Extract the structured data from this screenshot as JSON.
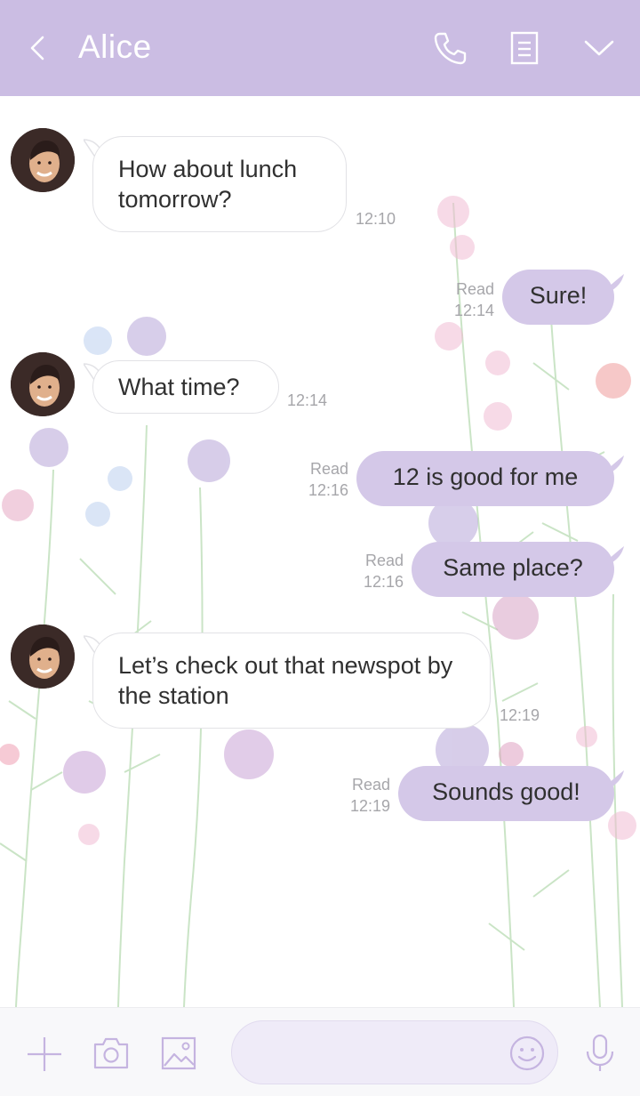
{
  "header": {
    "title": "Alice",
    "background": "#cbbde3",
    "icons": [
      "back-arrow-icon",
      "phone-icon",
      "notes-icon",
      "chevron-down-icon"
    ]
  },
  "messages": [
    {
      "from": "Alice",
      "direction": "incoming",
      "text": "How about lunch tomorrow?",
      "time": "12:10"
    },
    {
      "from": "me",
      "direction": "outgoing",
      "text": "Sure!",
      "status": "Read",
      "time": "12:14"
    },
    {
      "from": "Alice",
      "direction": "incoming",
      "text": "What time?",
      "time": "12:14"
    },
    {
      "from": "me",
      "direction": "outgoing",
      "text": "12 is good for me",
      "status": "Read",
      "time": "12:16"
    },
    {
      "from": "me",
      "direction": "outgoing",
      "text": "Same place?",
      "status": "Read",
      "time": "12:16"
    },
    {
      "from": "Alice",
      "direction": "incoming",
      "text": "Let’s check out that newspot by the station",
      "time": "12:19"
    },
    {
      "from": "me",
      "direction": "outgoing",
      "text": "Sounds good!",
      "status": "Read",
      "time": "12:19"
    }
  ],
  "composer": {
    "value": "",
    "placeholder": "",
    "icons": [
      "plus-icon",
      "camera-icon",
      "image-icon",
      "emoji-icon",
      "microphone-icon"
    ]
  },
  "colors": {
    "accent": "#cbbde3",
    "outgoing_bubble": "#d4c8e8",
    "incoming_bubble": "#ffffff",
    "meta_text": "#a6a6aa",
    "footer_icons": "#c5b4e0"
  }
}
